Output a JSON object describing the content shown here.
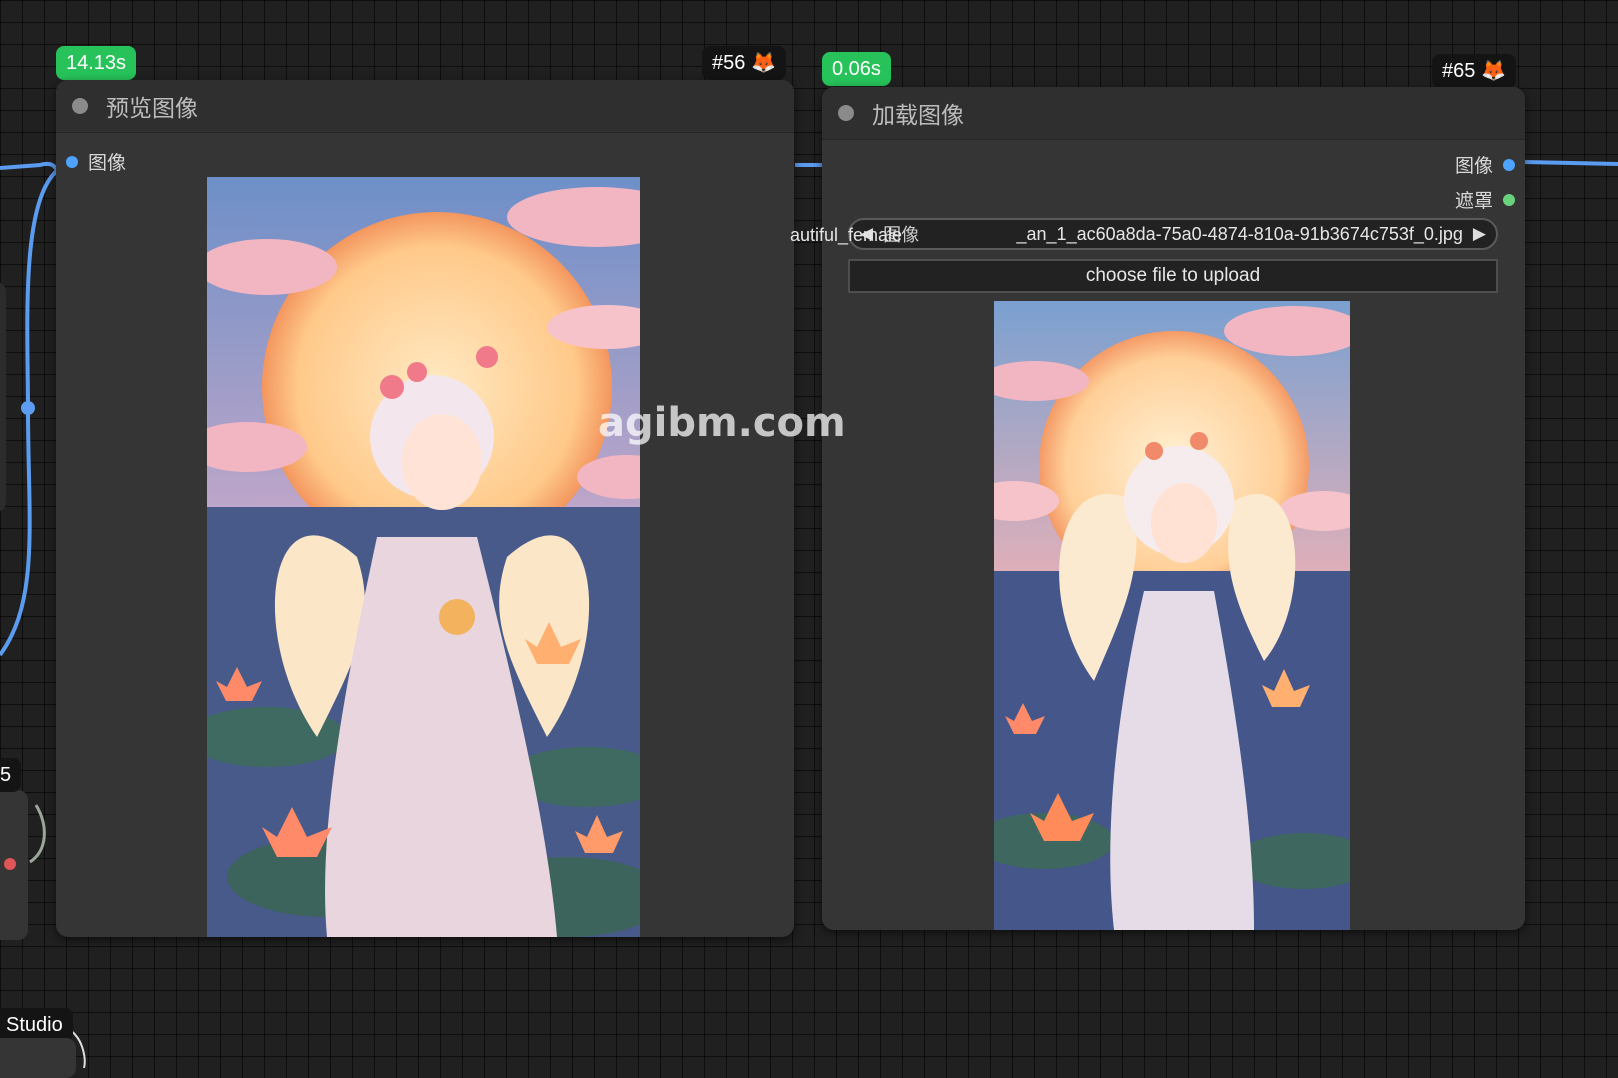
{
  "nodes": {
    "preview": {
      "exec_time": "14.13s",
      "node_id": "#56",
      "title": "预览图像",
      "input_label": "图像"
    },
    "load": {
      "exec_time": "0.06s",
      "node_id": "#65",
      "title": "加载图像",
      "output_image_label": "图像",
      "output_mask_label": "遮罩",
      "combo_overflow_text": "autiful_female",
      "combo_label": "图像",
      "filename": "_an_1_ac60a8da-75a0-4874-810a-91b3674c753f_0.jpg",
      "upload_label": "choose file to upload"
    }
  },
  "fragments": {
    "left_badge": "5",
    "bottom_label": "Studio"
  },
  "watermark": "agibm.com",
  "colors": {
    "image_slot": "#4da3ff",
    "mask_slot": "#6ad27a",
    "wire": "#5b9cf0",
    "time_badge": "#27c35a"
  },
  "icons": {
    "node_badge": "fox-icon"
  }
}
